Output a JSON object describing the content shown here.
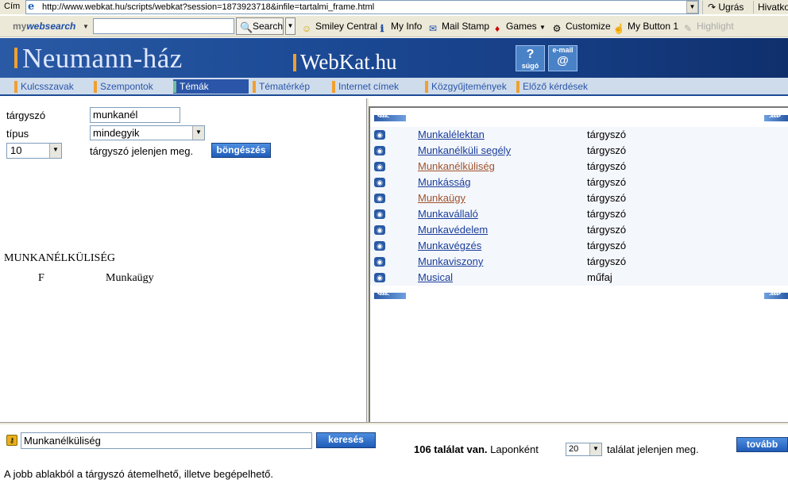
{
  "address_bar": {
    "label": "Cím",
    "url": "http://www.webkat.hu/scripts/webkat?session=1873923718&infile=tartalmi_frame.html",
    "go_label": "Ugrás",
    "links_label": "Hivatkoz"
  },
  "toolbar": {
    "brand_prefix": "my",
    "brand_main": "websearch",
    "search_value": "",
    "search_label": "Search",
    "items": [
      {
        "label": "Smiley Central",
        "icon": "smiley-icon"
      },
      {
        "label": "My Info",
        "icon": "info-icon"
      },
      {
        "label": "Mail Stamp",
        "icon": "stamp-icon"
      },
      {
        "label": "Games",
        "icon": "games-icon"
      },
      {
        "label": "Customize",
        "icon": "gear-icon"
      },
      {
        "label": "My Button 1",
        "icon": "hand-icon"
      },
      {
        "label": "Highlight",
        "icon": "highlight-icon"
      }
    ]
  },
  "header": {
    "site_name": "Neumann-ház",
    "service_name": "WebKat.hu",
    "help_label": "súgó",
    "mail_label": "e-mail"
  },
  "nav": {
    "tabs": [
      {
        "label": "Kulcsszavak",
        "active": false
      },
      {
        "label": "Szempontok",
        "active": false
      },
      {
        "label": "Témák",
        "active": true
      },
      {
        "label": "Tématérkép",
        "active": false
      },
      {
        "label": "Internet címek",
        "active": false
      },
      {
        "label": "Közgyűjtemények",
        "active": false
      },
      {
        "label": "Előző kérdések",
        "active": false
      }
    ]
  },
  "left": {
    "targyszo_label": "tárgyszó",
    "targyszo_value": "munkanél",
    "tipus_label": "típus",
    "tipus_value": "mindegyik",
    "count_value": "10",
    "count_suffix": "tárgyszó jelenjen meg.",
    "browse_label": "böngészés",
    "heading_term": "MUNKANÉLKÜLISÉG",
    "relation_type": "F",
    "relation_term": "Munkaügy"
  },
  "results": {
    "rows": [
      {
        "term": "Munkalélektan",
        "kind": "tárgyszó",
        "visited": false
      },
      {
        "term": "Munkanélküli segély",
        "kind": "tárgyszó",
        "visited": false
      },
      {
        "term": "Munkanélküliség",
        "kind": "tárgyszó",
        "visited": true
      },
      {
        "term": "Munkásság",
        "kind": "tárgyszó",
        "visited": false
      },
      {
        "term": "Munkaügy",
        "kind": "tárgyszó",
        "visited": true
      },
      {
        "term": "Munkavállaló",
        "kind": "tárgyszó",
        "visited": false
      },
      {
        "term": "Munkavédelem",
        "kind": "tárgyszó",
        "visited": false
      },
      {
        "term": "Munkavégzés",
        "kind": "tárgyszó",
        "visited": false
      },
      {
        "term": "Munkaviszony",
        "kind": "tárgyszó",
        "visited": false
      },
      {
        "term": "Musical",
        "kind": "műfaj",
        "visited": false
      }
    ]
  },
  "bottom": {
    "query_value": "Munkanélküliség",
    "search_label": "keresés",
    "hits_count": "106 találat van.",
    "per_page_label": "Laponként",
    "per_page_value": "20",
    "per_page_suffix": "találat jelenjen meg.",
    "next_label": "tovább",
    "hint": "A jobb ablakból a tárgyszó átemelhető, illetve begépelhető."
  },
  "colors": {
    "brand_blue": "#1c4a95",
    "accent_orange": "#f0a030",
    "link": "#1a3d9c",
    "visited_link": "#a0522d"
  }
}
